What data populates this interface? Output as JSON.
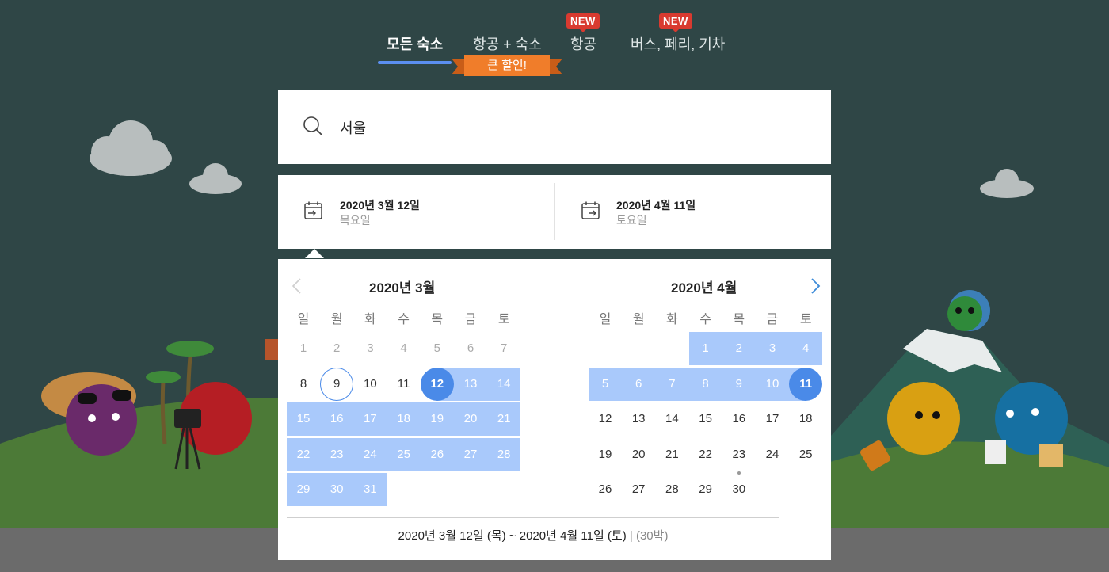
{
  "tabs": {
    "items": [
      {
        "label": "모든 숙소",
        "active": true
      },
      {
        "label": "항공 + 숙소",
        "active": false
      },
      {
        "label": "항공",
        "active": false
      },
      {
        "label": "버스, 페리, 기차",
        "active": false
      }
    ],
    "badge_flight": "NEW",
    "badge_transport": "NEW",
    "promo_ribbon": "큰 할인!"
  },
  "search": {
    "icon": "search-icon",
    "value": "서울"
  },
  "dates": {
    "checkin": {
      "date": "2020년 3월 12일",
      "weekday": "목요일",
      "icon": "calendar-checkin-icon"
    },
    "checkout": {
      "date": "2020년 4월 11일",
      "weekday": "토요일",
      "icon": "calendar-checkout-icon"
    }
  },
  "calendar": {
    "weekdays": [
      "일",
      "월",
      "화",
      "수",
      "목",
      "금",
      "토"
    ],
    "left": {
      "title": "2020년 3월",
      "days": [
        "1",
        "2",
        "3",
        "4",
        "5",
        "6",
        "7",
        "8",
        "9",
        "10",
        "11",
        "12",
        "13",
        "14",
        "15",
        "16",
        "17",
        "18",
        "19",
        "20",
        "21",
        "22",
        "23",
        "24",
        "25",
        "26",
        "27",
        "28",
        "29",
        "30",
        "31"
      ]
    },
    "right": {
      "title": "2020년 4월",
      "days": [
        "1",
        "2",
        "3",
        "4",
        "5",
        "6",
        "7",
        "8",
        "9",
        "10",
        "11",
        "12",
        "13",
        "14",
        "15",
        "16",
        "17",
        "18",
        "19",
        "20",
        "21",
        "22",
        "23",
        "24",
        "25",
        "26",
        "27",
        "28",
        "29",
        "30"
      ]
    },
    "summary": {
      "range": "2020년 3월 12일 (목) ~ 2020년 4월 11일 (토)",
      "separator": "|",
      "nights": "(30박)"
    }
  },
  "colors": {
    "accent": "#4a8ae8",
    "range": "#a9c9fb",
    "badge": "#d93a30",
    "ribbon": "#f07d2a",
    "background": "#2f4646"
  }
}
